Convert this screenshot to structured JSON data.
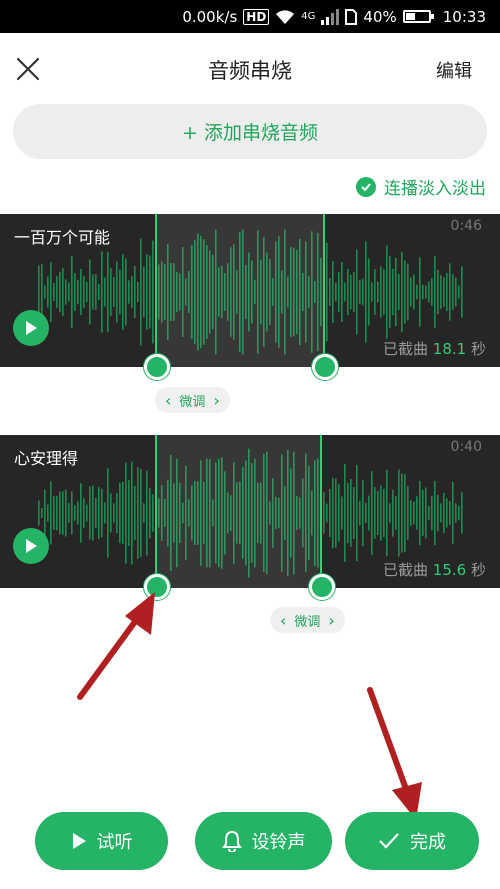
{
  "status_bar": {
    "speed": "0.00k/s",
    "hd": "HD",
    "network": "4G",
    "battery_percent": "40%",
    "battery_level": 0.4,
    "time": "10:33"
  },
  "header": {
    "title": "音频串烧",
    "edit_label": "编辑",
    "close_icon": "close-icon"
  },
  "add_button": {
    "label": "+ 添加串烧音频"
  },
  "crossfade": {
    "label": "连播淡入淡出",
    "checked": true
  },
  "tracks": [
    {
      "name": "一百万个可能",
      "duration": "0:46",
      "cut_prefix": "已截曲",
      "cut_value": "18.1",
      "cut_unit": "秒",
      "fine_tune_label": "微调"
    },
    {
      "name": "心安理得",
      "duration": "0:40",
      "cut_prefix": "已截曲",
      "cut_value": "15.6",
      "cut_unit": "秒",
      "fine_tune_label": "微调"
    }
  ],
  "bottom_buttons": {
    "preview": "试听",
    "ringtone": "设铃声",
    "done": "完成"
  },
  "colors": {
    "accent": "#25b365",
    "wave": "#1f8a4e",
    "track_bg": "#262626",
    "annotation_arrow": "#b02020"
  }
}
